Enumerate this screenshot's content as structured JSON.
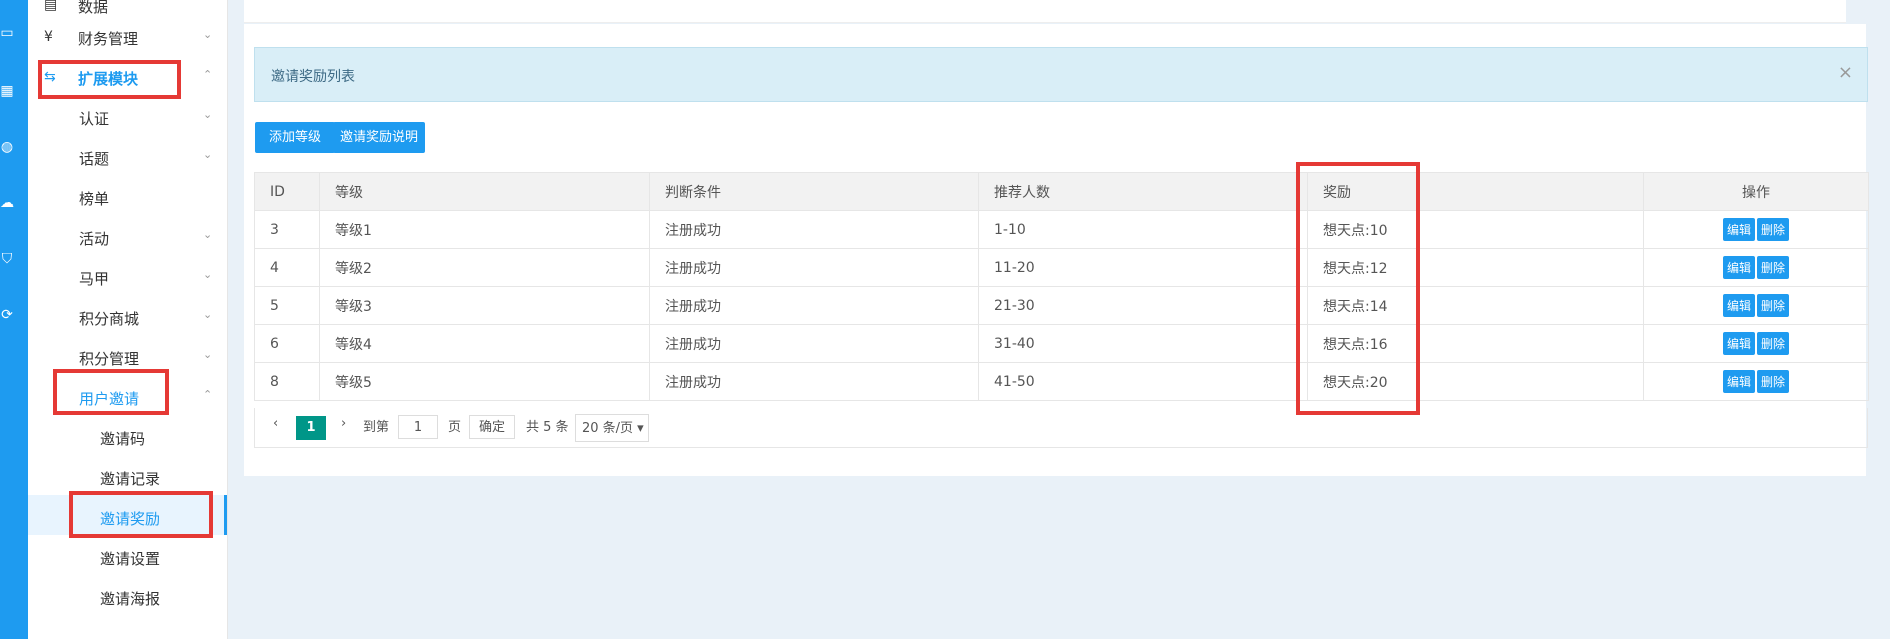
{
  "sidebar": {
    "items": [
      {
        "label": "数据"
      },
      {
        "label": "财务管理"
      },
      {
        "label": "扩展模块"
      },
      {
        "label": "认证"
      },
      {
        "label": "话题"
      },
      {
        "label": "榜单"
      },
      {
        "label": "活动"
      },
      {
        "label": "马甲"
      },
      {
        "label": "积分商城"
      },
      {
        "label": "积分管理"
      },
      {
        "label": "用户邀请"
      },
      {
        "label": "邀请码"
      },
      {
        "label": "邀请记录"
      },
      {
        "label": "邀请奖励"
      },
      {
        "label": "邀请设置"
      },
      {
        "label": "邀请海报"
      }
    ]
  },
  "alert": {
    "text": "邀请奖励列表",
    "close": "×"
  },
  "toolbar": {
    "add_level": "添加等级",
    "reward_info": "邀请奖励说明"
  },
  "table": {
    "headers": [
      "ID",
      "等级",
      "判断条件",
      "推荐人数",
      "奖励",
      "操作"
    ],
    "rows": [
      {
        "id": "3",
        "level": "等级1",
        "cond": "注册成功",
        "count": "1-10",
        "reward": "想天点:10"
      },
      {
        "id": "4",
        "level": "等级2",
        "cond": "注册成功",
        "count": "11-20",
        "reward": "想天点:12"
      },
      {
        "id": "5",
        "level": "等级3",
        "cond": "注册成功",
        "count": "21-30",
        "reward": "想天点:14"
      },
      {
        "id": "6",
        "level": "等级4",
        "cond": "注册成功",
        "count": "31-40",
        "reward": "想天点:16"
      },
      {
        "id": "8",
        "level": "等级5",
        "cond": "注册成功",
        "count": "41-50",
        "reward": "想天点:20"
      }
    ],
    "edit_label": "编辑",
    "delete_label": "删除"
  },
  "pager": {
    "prev": "‹",
    "current": "1",
    "next": "›",
    "goto": "到第",
    "page_input": "1",
    "page_unit": "页",
    "confirm": "确定",
    "total": "共 5 条",
    "page_size": "20 条/页 ▾"
  }
}
